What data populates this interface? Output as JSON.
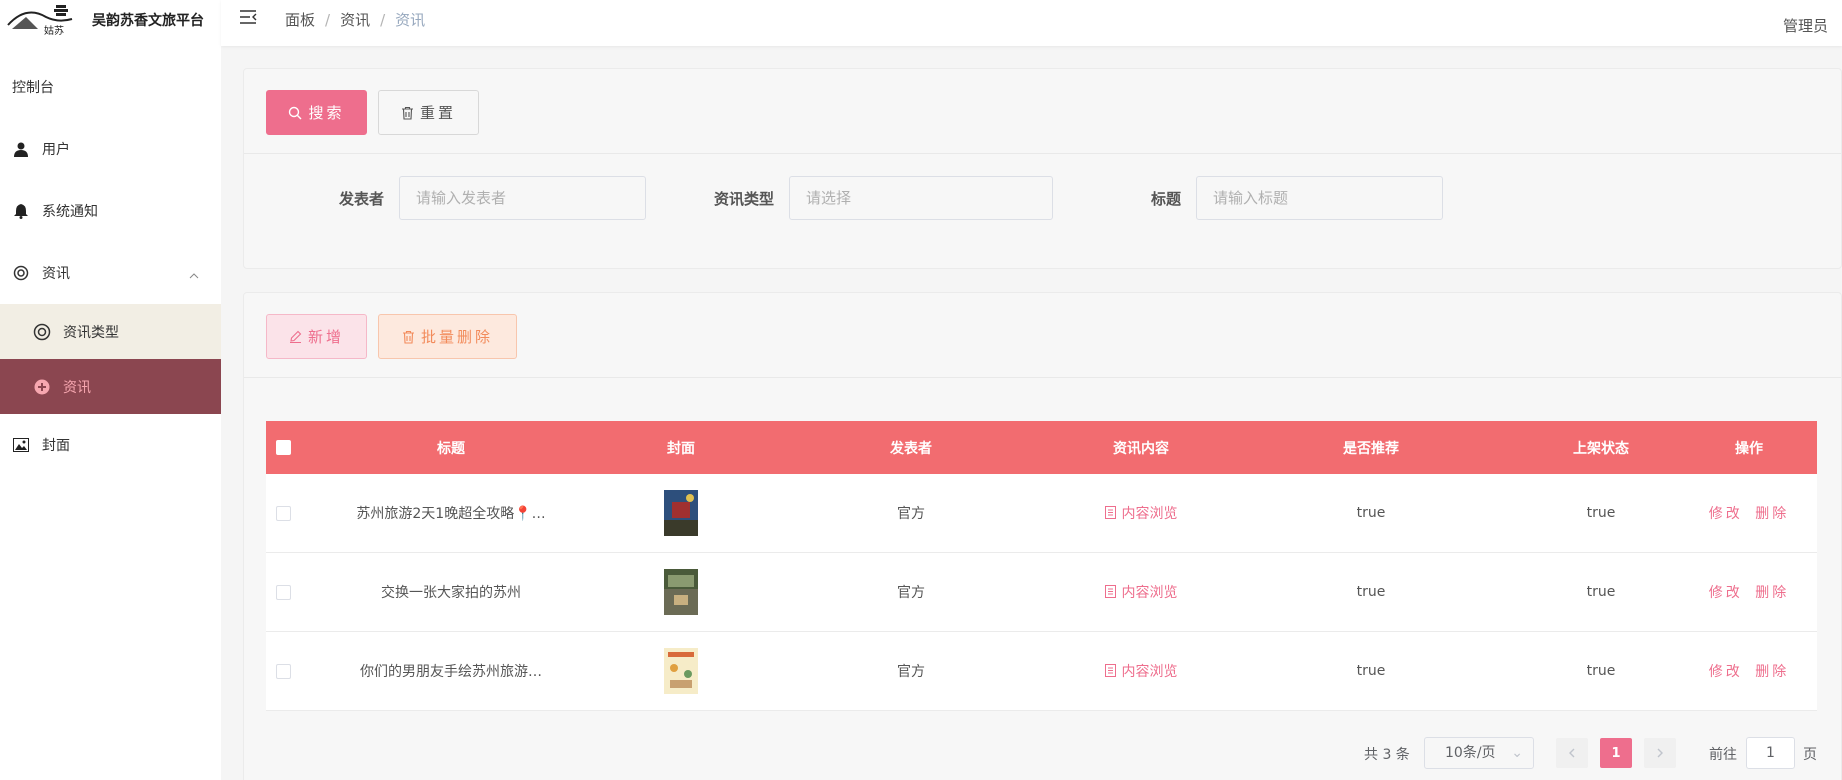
{
  "app": {
    "title": "吴韵苏香文旅平台",
    "logo_text": "姑苏"
  },
  "sidebar": {
    "items": [
      {
        "label": "控制台"
      },
      {
        "label": "用户",
        "icon": "user-icon"
      },
      {
        "label": "系统通知",
        "icon": "bell-icon"
      },
      {
        "label": "资讯",
        "icon": "lifebuoy-icon",
        "expanded": true
      },
      {
        "label": "资讯类型",
        "icon": "lifebuoy-icon"
      },
      {
        "label": "资讯",
        "icon": "plus-circle-icon",
        "active": true
      },
      {
        "label": "封面",
        "icon": "image-icon"
      }
    ]
  },
  "header": {
    "breadcrumb": [
      "面板",
      "资讯",
      "资讯"
    ],
    "user": "管理员"
  },
  "search": {
    "search_label": "搜索",
    "reset_label": "重置",
    "publisher_label": "发表者",
    "publisher_placeholder": "请输入发表者",
    "type_label": "资讯类型",
    "type_placeholder": "请选择",
    "title_label": "标题",
    "title_placeholder": "请输入标题"
  },
  "actions": {
    "add_label": "新增",
    "batch_delete_label": "批量删除"
  },
  "table": {
    "columns": [
      "标题",
      "封面",
      "发表者",
      "资讯内容",
      "是否推荐",
      "上架状态",
      "操作"
    ],
    "rows": [
      {
        "title": "苏州旅游2天1晚超全攻略📍…",
        "publisher": "官方",
        "content_link": "内容浏览",
        "recommended": "true",
        "status": "true",
        "edit": "修改",
        "delete": "删除"
      },
      {
        "title": "交换一张大家拍的苏州",
        "publisher": "官方",
        "content_link": "内容浏览",
        "recommended": "true",
        "status": "true",
        "edit": "修改",
        "delete": "删除"
      },
      {
        "title": "你们的男朋友手绘苏州旅游…",
        "publisher": "官方",
        "content_link": "内容浏览",
        "recommended": "true",
        "status": "true",
        "edit": "修改",
        "delete": "删除"
      }
    ]
  },
  "pagination": {
    "total": "共 3 条",
    "page_size": "10条/页",
    "current_page": "1",
    "goto_label": "前往",
    "goto_value": "1",
    "page_suffix": "页"
  },
  "colors": {
    "accent": "#ee6e8d",
    "table_header": "#f26c70",
    "active_menu": "#8b4650"
  }
}
